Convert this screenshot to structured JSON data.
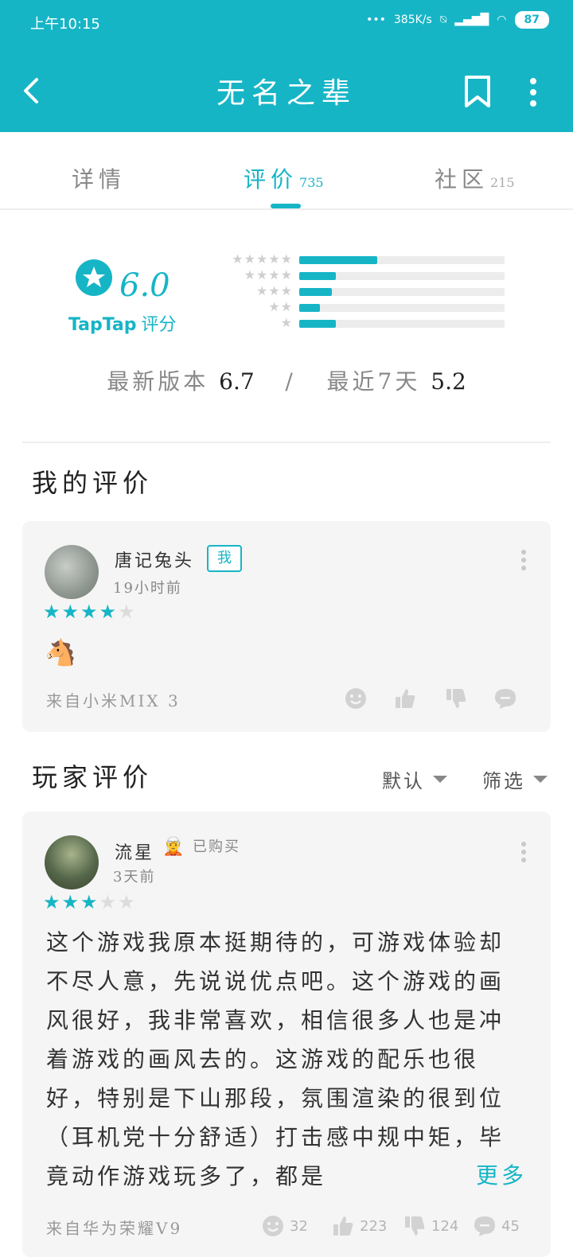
{
  "status": {
    "time": "上午10:15",
    "net_speed": "385K/s",
    "battery": "87"
  },
  "header": {
    "title": "无名之辈",
    "back_icon": "chevron-left-icon",
    "bookmark_icon": "bookmark-icon",
    "more_icon": "more-vertical-icon"
  },
  "tabs": [
    {
      "label": "详情",
      "count": ""
    },
    {
      "label": "评价",
      "count": "735"
    },
    {
      "label": "社区",
      "count": "215"
    }
  ],
  "rating": {
    "score": "6.0",
    "brand": "TapTap",
    "brand_suffix": "评分",
    "distribution": [
      {
        "stars": "★★★★★",
        "fraction": 0.38
      },
      {
        "stars": "★★★★",
        "fraction": 0.18
      },
      {
        "stars": "★★★",
        "fraction": 0.16
      },
      {
        "stars": "★★",
        "fraction": 0.1
      },
      {
        "stars": "★",
        "fraction": 0.18
      }
    ],
    "latest_label": "最新版本",
    "latest_value": "6.7",
    "divider": "/",
    "recent_label": "最近7天",
    "recent_value": "5.2"
  },
  "my_review": {
    "section_title": "我的评价",
    "username": "唐记兔头",
    "badge": "我",
    "time": "19小时前",
    "stars_on": "★★★★",
    "stars_off": "★",
    "content": "🐴",
    "device": "来自小米MIX 3"
  },
  "player_reviews": {
    "section_title": "玩家评价",
    "sort_default": "默认",
    "sort_filter": "筛选",
    "items": [
      {
        "username": "流星",
        "badge_emoji": "🧝",
        "bought": "已购买",
        "time": "3天前",
        "stars_on": "★★★",
        "stars_off": "★★",
        "content": "这个游戏我原本挺期待的，可游戏体验却不尽人意，先说说优点吧。这个游戏的画风很好，我非常喜欢，相信很多人也是冲着游戏的画风去的。这游戏的配乐也很好，特别是下山那段，氛围渲染的很到位（耳机党十分舒适）打击感中规中矩，毕竟动作游戏玩多了，都是",
        "more": "更多",
        "device": "来自华为荣耀V9",
        "fun": "32",
        "likes": "223",
        "dislikes": "124",
        "comments": "45"
      }
    ]
  },
  "colors": {
    "accent": "#16b5c6",
    "card_bg": "#f5f5f5"
  }
}
